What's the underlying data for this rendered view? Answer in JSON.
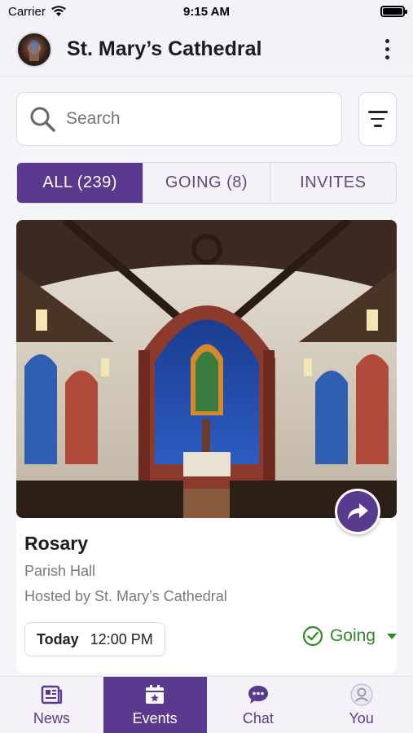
{
  "status_bar": {
    "carrier": "Carrier",
    "time": "9:15 AM"
  },
  "header": {
    "title": "St. Mary’s Cathedral"
  },
  "search": {
    "placeholder": "Search"
  },
  "tabs": [
    {
      "label": "ALL (239)",
      "active": true
    },
    {
      "label": "GOING (8)",
      "active": false
    },
    {
      "label": "INVITES",
      "active": false
    }
  ],
  "event": {
    "title": "Rosary",
    "location": "Parish Hall",
    "host": "Hosted by St. Mary’s Cathedral",
    "day": "Today",
    "time": "12:00 PM",
    "rsvp_status": "Going"
  },
  "bottom_nav": [
    {
      "label": "News",
      "icon": "newspaper-icon",
      "active": false
    },
    {
      "label": "Events",
      "icon": "calendar-star-icon",
      "active": true
    },
    {
      "label": "Chat",
      "icon": "chat-bubble-icon",
      "active": false
    },
    {
      "label": "You",
      "icon": "user-icon",
      "active": false
    }
  ],
  "colors": {
    "accent": "#5a3a8f",
    "going": "#2e8b22"
  }
}
